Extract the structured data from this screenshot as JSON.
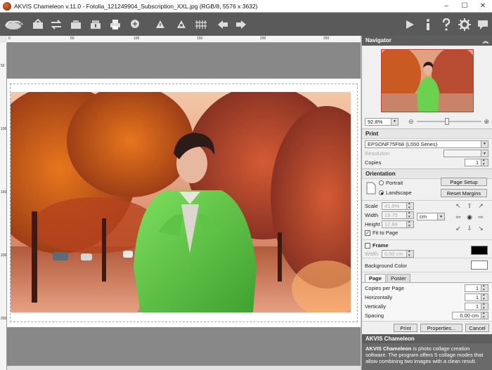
{
  "window": {
    "title": "AKVIS Chameleon v.11.0 - Fotolia_121249904_Subscription_XXL.jpg (RGB/8, 5576 x 3632)",
    "minimize": "–",
    "maximize": "☐",
    "close": "✕"
  },
  "ruler": {
    "top_labels": [
      "0",
      "50",
      "100",
      "150",
      "200",
      "250"
    ],
    "left_labels": [
      "50",
      "100",
      "150",
      "200",
      "250"
    ]
  },
  "navigator": {
    "title": "Navigator",
    "zoom_value": "92.8%"
  },
  "print": {
    "title": "Print",
    "printer": "EPSONF75F68 (L550 Series)",
    "resolution_label": "Resolution",
    "copies_label": "Copies",
    "copies_value": "1"
  },
  "orientation": {
    "title": "Orientation",
    "portrait": "Portrait",
    "landscape": "Landscape",
    "page_setup": "Page Setup",
    "reset_margins": "Reset Margins",
    "selected": "landscape"
  },
  "scale": {
    "scale_label": "Scale",
    "scale_value": "41.8%",
    "width_label": "Width",
    "width_value": "19.75",
    "height_label": "Height",
    "height_value": "12.86",
    "unit": "cm",
    "fit_to_page": "Fit to Page",
    "fit_checked": true
  },
  "frame": {
    "title": "Frame",
    "width_label": "Width",
    "width_value": "0.50 cm",
    "frame_color": "#000000"
  },
  "background": {
    "label": "Background Color",
    "color": "#ffffff"
  },
  "layout_tabs": {
    "tab_page": "Page",
    "tab_poster": "Poster",
    "copies_per_page_label": "Copies per Page",
    "copies_per_page_value": "1",
    "horizontally_label": "Horizontally",
    "horizontally_value": "1",
    "vertically_label": "Vertically",
    "vertically_value": "1",
    "spacing_label": "Spacing",
    "spacing_value": "0.00 cm"
  },
  "actions": {
    "print": "Print",
    "properties": "Properties...",
    "cancel": "Cancel"
  },
  "info": {
    "title": "AKVIS Chameleon",
    "app_name": "AKVIS Chameleon",
    "text": " is photo collage creation software. The program offers 5 collage modes that allow combining two images with a clean result."
  }
}
